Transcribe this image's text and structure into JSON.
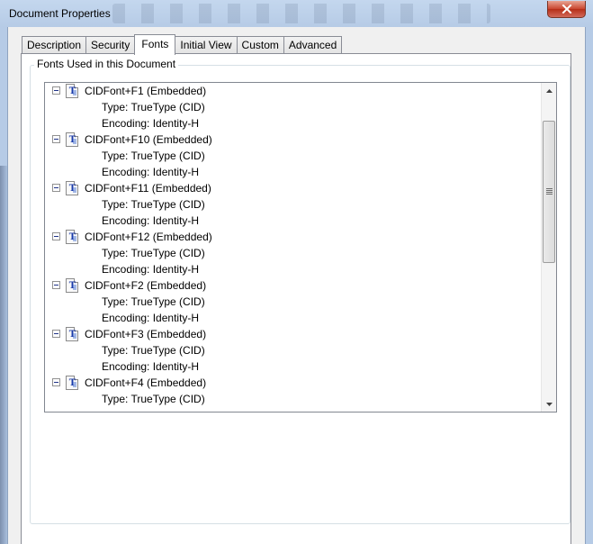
{
  "window": {
    "title": "Document Properties",
    "close_icon": "close-x-icon"
  },
  "tabs": [
    {
      "label": "Description",
      "active": false
    },
    {
      "label": "Security",
      "active": false
    },
    {
      "label": "Fonts",
      "active": true
    },
    {
      "label": "Initial View",
      "active": false
    },
    {
      "label": "Custom",
      "active": false
    },
    {
      "label": "Advanced",
      "active": false
    }
  ],
  "fonts_group": {
    "label": "Fonts Used in this Document"
  },
  "fonts": [
    {
      "name": "CIDFont+F1 (Embedded)",
      "type": "Type: TrueType (CID)",
      "encoding": "Encoding: Identity-H"
    },
    {
      "name": "CIDFont+F10 (Embedded)",
      "type": "Type: TrueType (CID)",
      "encoding": "Encoding: Identity-H"
    },
    {
      "name": "CIDFont+F11 (Embedded)",
      "type": "Type: TrueType (CID)",
      "encoding": "Encoding: Identity-H"
    },
    {
      "name": "CIDFont+F12 (Embedded)",
      "type": "Type: TrueType (CID)",
      "encoding": "Encoding: Identity-H"
    },
    {
      "name": "CIDFont+F2 (Embedded)",
      "type": "Type: TrueType (CID)",
      "encoding": "Encoding: Identity-H"
    },
    {
      "name": "CIDFont+F3 (Embedded)",
      "type": "Type: TrueType (CID)",
      "encoding": "Encoding: Identity-H"
    },
    {
      "name": "CIDFont+F4 (Embedded)",
      "type": "Type: TrueType (CID)",
      "encoding": ""
    }
  ],
  "icons": {
    "collapse": "collapse-minus-icon",
    "font_file": "truetype-font-icon",
    "scroll_up": "scroll-up-arrow-icon",
    "scroll_down": "scroll-down-arrow-icon"
  },
  "colors": {
    "window_frame": "#b6cbe6",
    "close_button": "#c9452e",
    "icon_blue": "#1a3aa8"
  }
}
